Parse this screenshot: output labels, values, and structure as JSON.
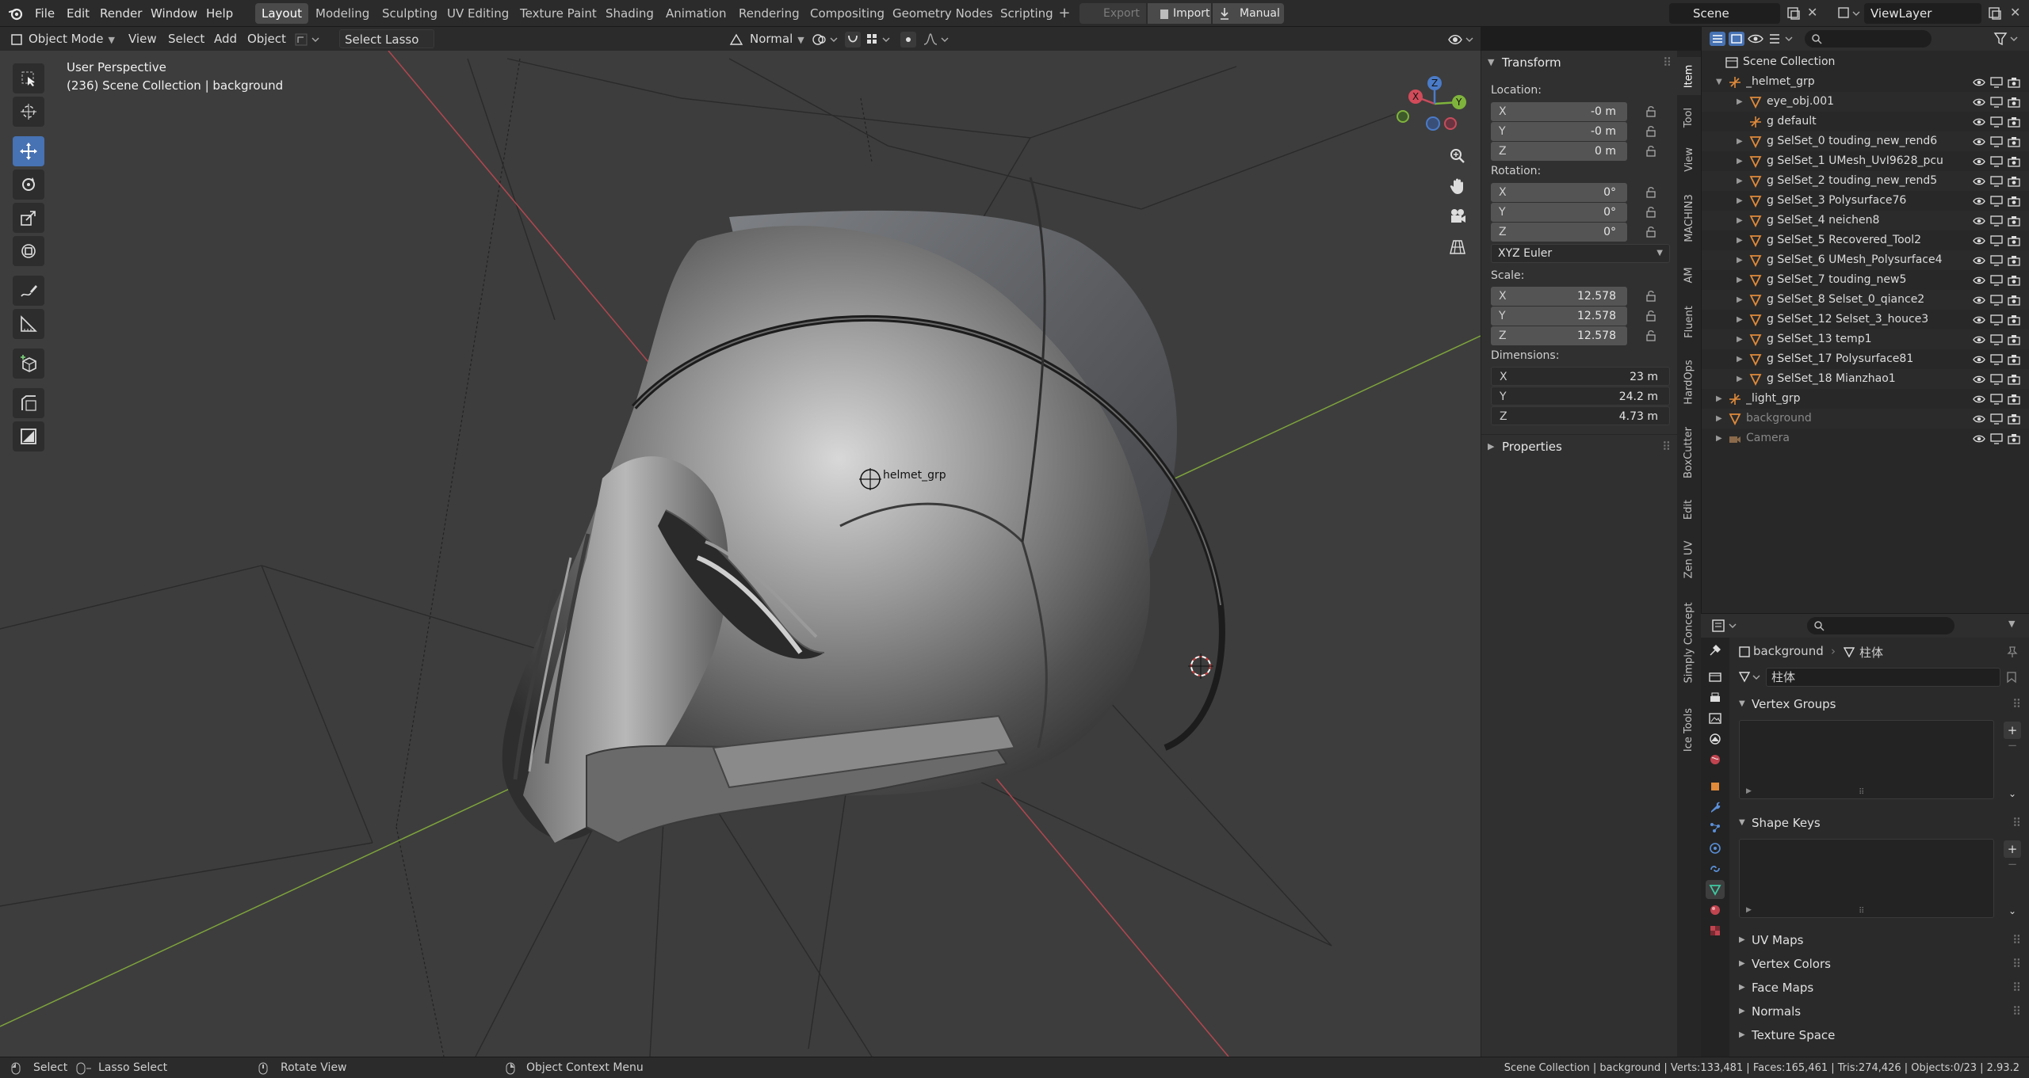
{
  "top_menu": {
    "items": [
      "File",
      "Edit",
      "Render",
      "Window",
      "Help"
    ],
    "workspace_tabs": [
      "Layout",
      "Modeling",
      "Sculpting",
      "UV Editing",
      "Texture Paint",
      "Shading",
      "Animation",
      "Rendering",
      "Compositing",
      "Geometry Nodes",
      "Scripting"
    ],
    "active_tab": "Layout",
    "plus": "+",
    "export_label": "Export",
    "import_label": "Import",
    "manual_label": "Manual",
    "scene_name": "Scene",
    "view_layer": "ViewLayer"
  },
  "viewport_header": {
    "mode": "Object Mode",
    "menus": [
      "View",
      "Select",
      "Add",
      "Object"
    ],
    "select_tool": "Select Lasso",
    "transform_orientation": "Normal"
  },
  "viewport": {
    "perspective_label": "User Perspective",
    "context_label": "(236) Scene Collection | background",
    "object_label": "helmet_grp",
    "gizmo_x": "X",
    "gizmo_y": "Y",
    "gizmo_z": "Z"
  },
  "npanel": {
    "transform_title": "Transform",
    "location_label": "Location:",
    "location": [
      {
        "axis": "X",
        "value": "-0 m"
      },
      {
        "axis": "Y",
        "value": "-0 m"
      },
      {
        "axis": "Z",
        "value": "0 m"
      }
    ],
    "rotation_label": "Rotation:",
    "rotation": [
      {
        "axis": "X",
        "value": "0°"
      },
      {
        "axis": "Y",
        "value": "0°"
      },
      {
        "axis": "Z",
        "value": "0°"
      }
    ],
    "rotation_mode": "XYZ Euler",
    "scale_label": "Scale:",
    "scale": [
      {
        "axis": "X",
        "value": "12.578"
      },
      {
        "axis": "Y",
        "value": "12.578"
      },
      {
        "axis": "Z",
        "value": "12.578"
      }
    ],
    "dimensions_label": "Dimensions:",
    "dimensions": [
      {
        "axis": "X",
        "value": "23 m"
      },
      {
        "axis": "Y",
        "value": "24.2 m"
      },
      {
        "axis": "Z",
        "value": "4.73 m"
      }
    ],
    "properties_title": "Properties"
  },
  "vertical_tabs": [
    "Item",
    "Tool",
    "View",
    "MACHIN3",
    "AM",
    "Fluent",
    "HardOps",
    "BoxCutter",
    "Edit",
    "Zen UV",
    "Simply Concept",
    "Ice Tools"
  ],
  "outliner": {
    "root": "Scene Collection",
    "rows": [
      {
        "name": "_helmet_grp",
        "indent": 0,
        "icon": "empty-icon"
      },
      {
        "name": "eye_obj.001",
        "indent": 1,
        "icon": "mesh-icon"
      },
      {
        "name": "g default",
        "indent": 1,
        "icon": "empty-icon"
      },
      {
        "name": "g SelSet_0 touding_new_rend6",
        "indent": 1,
        "icon": "mesh-icon"
      },
      {
        "name": "g SelSet_1 UMesh_UvI9628_pcu",
        "indent": 1,
        "icon": "mesh-icon"
      },
      {
        "name": "g SelSet_2 touding_new_rend5",
        "indent": 1,
        "icon": "mesh-icon"
      },
      {
        "name": "g SelSet_3 Polysurface76",
        "indent": 1,
        "icon": "mesh-icon"
      },
      {
        "name": "g SelSet_4 neichen8",
        "indent": 1,
        "icon": "mesh-icon"
      },
      {
        "name": "g SelSet_5 Recovered_Tool2",
        "indent": 1,
        "icon": "mesh-icon"
      },
      {
        "name": "g SelSet_6 UMesh_Polysurface4",
        "indent": 1,
        "icon": "mesh-icon"
      },
      {
        "name": "g SelSet_7 touding_new5",
        "indent": 1,
        "icon": "mesh-icon"
      },
      {
        "name": "g SelSet_8 Selset_0_qiance2",
        "indent": 1,
        "icon": "mesh-icon"
      },
      {
        "name": "g SelSet_12 Selset_3_houce3",
        "indent": 1,
        "icon": "mesh-icon"
      },
      {
        "name": "g SelSet_13 temp1",
        "indent": 1,
        "icon": "mesh-icon"
      },
      {
        "name": "g SelSet_17 Polysurface81",
        "indent": 1,
        "icon": "mesh-icon"
      },
      {
        "name": "g SelSet_18 Mianzhao1",
        "indent": 1,
        "icon": "mesh-icon"
      },
      {
        "name": "_light_grp",
        "indent": 0,
        "icon": "empty-icon"
      },
      {
        "name": "background",
        "indent": 0,
        "icon": "mesh-icon"
      },
      {
        "name": "Camera",
        "indent": 0,
        "icon": "camera-icon"
      }
    ]
  },
  "properties": {
    "object_name": "background",
    "mesh_name": "柱体",
    "mesh_field": "柱体",
    "panels": [
      "Vertex Groups",
      "Shape Keys",
      "UV Maps",
      "Vertex Colors",
      "Face Maps",
      "Normals",
      "Texture Space"
    ]
  },
  "statusbar": {
    "select": "Select",
    "lasso": "Lasso Select",
    "rotate": "Rotate View",
    "context_menu": "Object Context Menu",
    "stats": "Scene Collection | background | Verts:133,481 | Faces:165,461 | Tris:274,426 | Objects:0/23 | 2.93.2"
  },
  "colors": {
    "accent": "#4772b3",
    "viewport_bg": "#3d3d3d",
    "x_axis": "#c05060",
    "y_axis": "#8ab04a",
    "mesh_icon": "#e08a3a",
    "vertex_group_icon": "#3ec9a0"
  }
}
